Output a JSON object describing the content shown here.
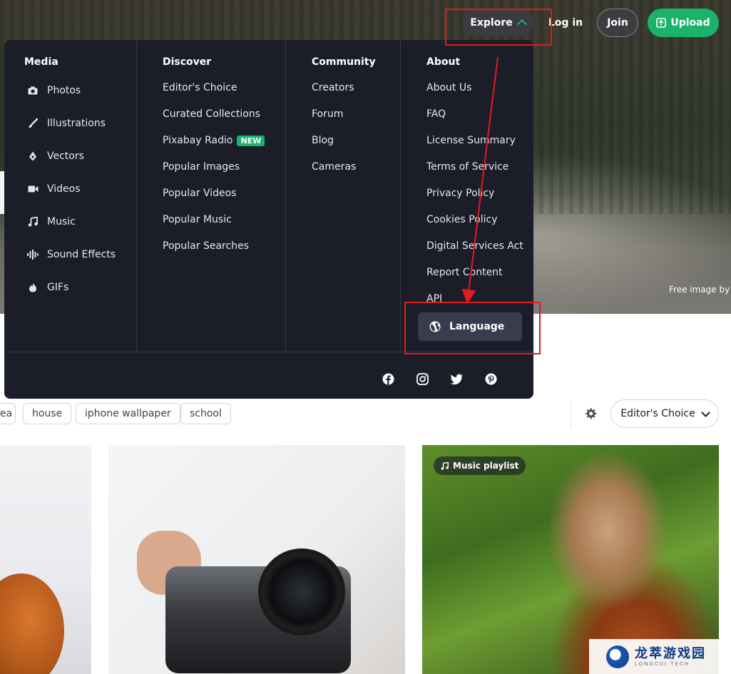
{
  "nav": {
    "explore_label": "Explore",
    "login_label": "Log in",
    "join_label": "Join",
    "upload_label": "Upload"
  },
  "hero": {
    "credit": "Free image by j"
  },
  "menu": {
    "media": {
      "heading": "Media",
      "items": [
        {
          "label": "Photos",
          "icon": "camera-icon"
        },
        {
          "label": "Illustrations",
          "icon": "brush-icon"
        },
        {
          "label": "Vectors",
          "icon": "vector-pen-icon"
        },
        {
          "label": "Videos",
          "icon": "video-camera-icon"
        },
        {
          "label": "Music",
          "icon": "music-note-icon"
        },
        {
          "label": "Sound Effects",
          "icon": "sound-wave-icon"
        },
        {
          "label": "GIFs",
          "icon": "flame-icon"
        }
      ]
    },
    "discover": {
      "heading": "Discover",
      "items": [
        "Editor's Choice",
        "Curated Collections",
        "Pixabay Radio",
        "Popular Images",
        "Popular Videos",
        "Popular Music",
        "Popular Searches"
      ],
      "new_badge": "NEW"
    },
    "community": {
      "heading": "Community",
      "items": [
        "Creators",
        "Forum",
        "Blog",
        "Cameras"
      ]
    },
    "about": {
      "heading": "About",
      "items": [
        "About Us",
        "FAQ",
        "License Summary",
        "Terms of Service",
        "Privacy Policy",
        "Cookies Policy",
        "Digital Services Act",
        "Report Content",
        "API"
      ]
    },
    "language_label": "Language",
    "social": [
      "facebook-icon",
      "instagram-icon",
      "twitter-icon",
      "pinterest-icon"
    ]
  },
  "tags": {
    "items": [
      "ea",
      "house",
      "iphone wallpaper",
      "school"
    ]
  },
  "sort": {
    "label": "Editor's Choice"
  },
  "grid": {
    "playlist_badge": "Music playlist"
  },
  "watermark": {
    "name": "龙萃游戏园",
    "sub": "LONGCUI TECH"
  },
  "colors": {
    "brand_green": "#19b36b",
    "menu_bg": "#1b1d29",
    "annotation_red": "#e31b1b"
  }
}
